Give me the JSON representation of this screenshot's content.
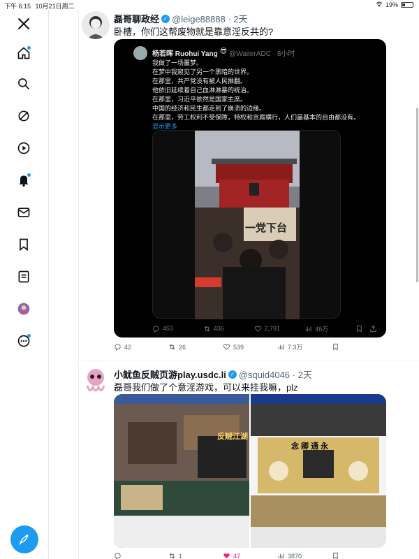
{
  "status": {
    "time": "下午 6:15",
    "date": "10月21日周二",
    "battery": "19%"
  },
  "sidebar": {
    "icons": [
      "x-logo-icon",
      "home-icon",
      "search-icon",
      "grok-icon",
      "video-icon",
      "notifications-icon",
      "messages-icon",
      "bookmarks-icon",
      "lists-icon",
      "avatar-icon",
      "more-icon"
    ]
  },
  "tweet1": {
    "name": "磊哥聊政经",
    "handle": "@leige88888 · 2天",
    "text": "卧槽，你们这帮废物就是靠意淫反共的?",
    "quote": {
      "name": "杨若晖 Ruohui Yang",
      "handle": "@WaiterADC · 8小时",
      "lines": [
        "我做了一场噩梦。",
        "在梦中我窥见了另一个黑暗的世界。",
        "在那里，共产党没有被人民推翻。",
        "他依旧延续着自己血淋淋暴的统治。",
        "在那里，习近平依然是国家主席。",
        "中国的经济和民生都走到了崩溃的边缘。",
        "在那里，劳工权利不受保障，特权和贪腐横行，人们最基本的自由都没有。"
      ],
      "show_more": "显示更多",
      "photo_sign": "一党下台",
      "actions": {
        "reply": "453",
        "repost": "436",
        "like": "2,791",
        "views": "46万"
      }
    },
    "actions": {
      "reply": "42",
      "repost": "26",
      "like": "539",
      "views": "7.3万"
    }
  },
  "tweet2": {
    "name": "小鱿鱼反贼页游play.usdc.li",
    "handle": "@squid4046 · 2天",
    "text": "磊哥我们做了个意淫游戏，可以来挂我嘛，plz",
    "game1_title": "反贼江湖",
    "game2_title": "念 卿 通 永",
    "actions": {
      "reply": "",
      "repost": "1",
      "like": "47",
      "views": "3870"
    }
  }
}
